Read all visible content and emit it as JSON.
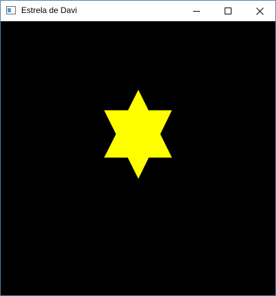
{
  "window": {
    "title": "Estrela de Davi",
    "controls": {
      "minimize_icon": "minimize-icon",
      "maximize_icon": "maximize-icon",
      "close_icon": "close-icon"
    }
  },
  "canvas": {
    "background_color": "#000000",
    "star_color": "#ffff00",
    "shape": "hexagram"
  }
}
